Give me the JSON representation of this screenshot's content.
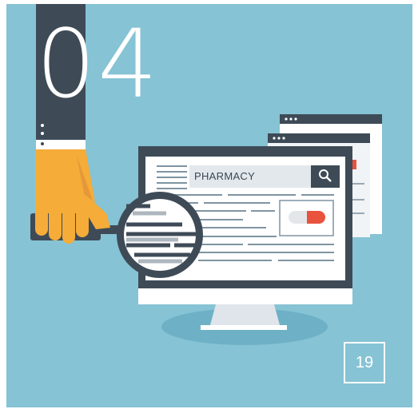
{
  "illustration": {
    "number": "04",
    "search_text": "PHARMACY",
    "page_number": "19",
    "icons": [
      "search-icon",
      "magnifier-icon",
      "pill-icon",
      "hand-icon",
      "computer-monitor-icon"
    ],
    "colors": {
      "background": "#86c3d4",
      "dark": "#3e4b57",
      "hand": "#f5ac38",
      "pill_red": "#e9523d",
      "white": "#ffffff"
    }
  }
}
